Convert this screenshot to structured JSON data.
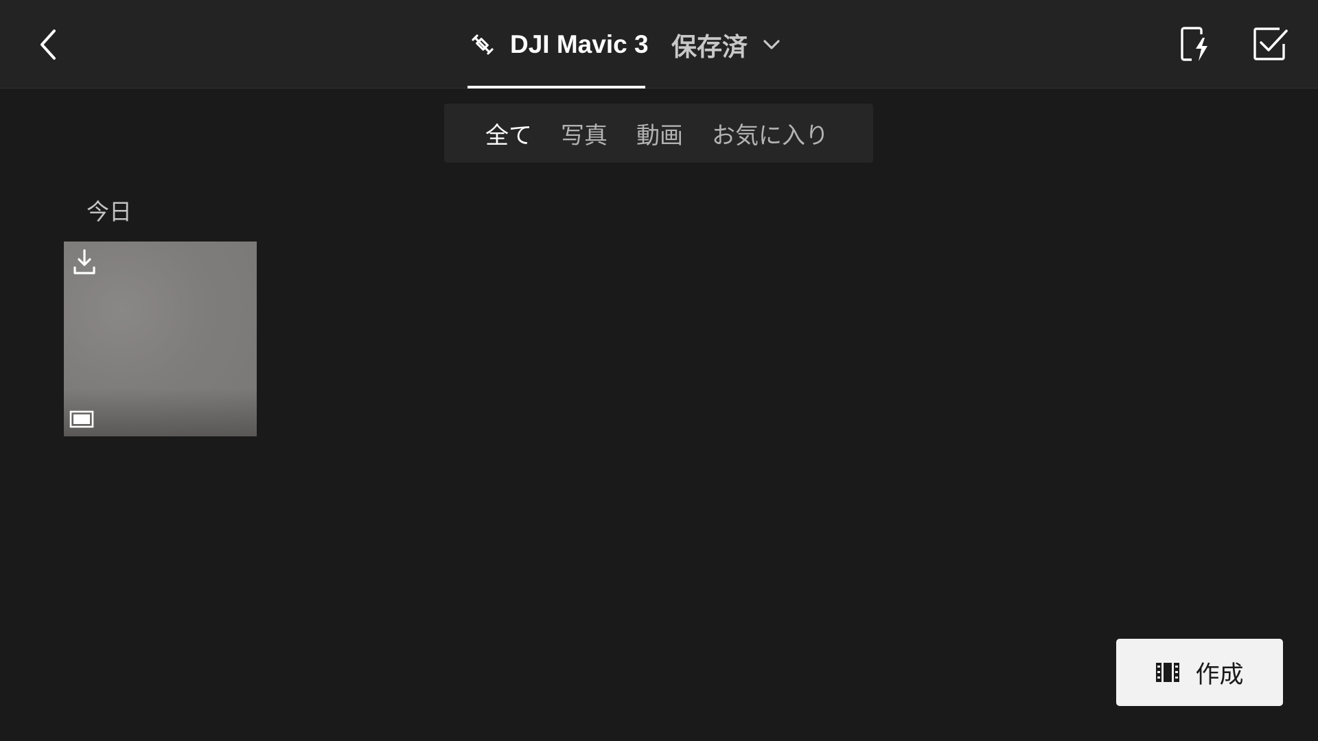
{
  "header": {
    "back_icon": "chevron-left-icon",
    "device_icon": "drone-icon",
    "device_tab_label": "DJI Mavic 3",
    "saved_label": "保存済",
    "saved_dropdown_icon": "chevron-down-icon",
    "actions": [
      {
        "icon": "phone-flash-icon"
      },
      {
        "icon": "select-checkbox-icon"
      }
    ]
  },
  "filters": {
    "items": [
      "全て",
      "写真",
      "動画",
      "お気に入り"
    ],
    "active": "全て"
  },
  "gallery": {
    "sections": [
      {
        "date_label": "今日",
        "items": [
          {
            "type": "photo",
            "badge_icon": "download-icon",
            "type_icon": "photo-icon"
          }
        ]
      }
    ]
  },
  "create_button": {
    "label": "作成",
    "icon": "film-strip-icon"
  },
  "colors": {
    "background": "#1a1a1a",
    "header_background": "#232323",
    "filter_background": "#262626",
    "button_background": "#f2f2f2"
  }
}
